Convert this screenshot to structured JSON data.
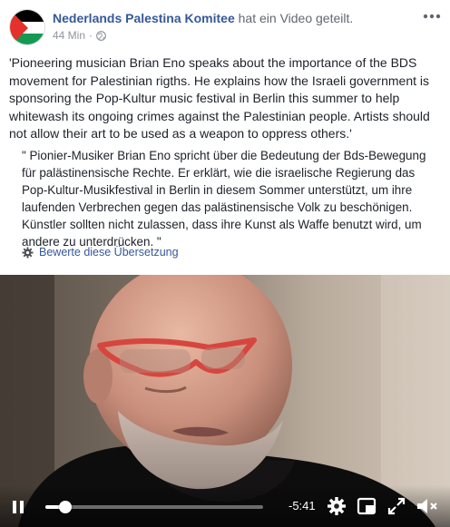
{
  "post": {
    "page_name": "Nederlands Palestina Komitee",
    "action_text": "hat ein Video geteilt.",
    "timestamp": "44 Min",
    "separator": "·",
    "text": "'Pioneering musician Brian Eno speaks about the importance of the BDS movement for Palestinian rigths. He explains how the Israeli government is sponsoring the Pop-Kultur music festival in Berlin this summer to help whitewash its ongoing crimes against the Palestinian people. Artists should not allow their art to be used as a weapon to oppress others.'",
    "translation": "\" Pionier-Musiker Brian Eno spricht über die Bedeutung der Bds-Bewegung für palästinensische Rechte. Er erklärt, wie die israelische Regierung das Pop-Kultur-Musikfestival in Berlin in diesem Sommer unterstützt, um ihre laufenden Verbrechen gegen das palästinensische Volk zu beschönigen. Künstler sollten nicht zulassen, dass ihre Kunst als Waffe benutzt wird, um andere zu unterdrücken. \"",
    "rate_translation": "Bewerte diese Übersetzung"
  },
  "video": {
    "time_remaining": "-5:41",
    "progress": 0.09
  },
  "icons": {
    "avatar": "palestine-flag-icon",
    "privacy": "globe-icon",
    "more": "more-options-icon",
    "rate": "gear-icon",
    "play_state": "pause-icon",
    "settings": "settings-gear-icon",
    "pip": "picture-in-picture-icon",
    "fullscreen": "fullscreen-icon",
    "volume": "volume-muted-icon"
  },
  "colors": {
    "link": "#365899",
    "text": "#1d2129",
    "meta": "#90949c",
    "flag_black": "#000000",
    "flag_white": "#ffffff",
    "flag_green": "#149954",
    "flag_red": "#e4312b"
  }
}
